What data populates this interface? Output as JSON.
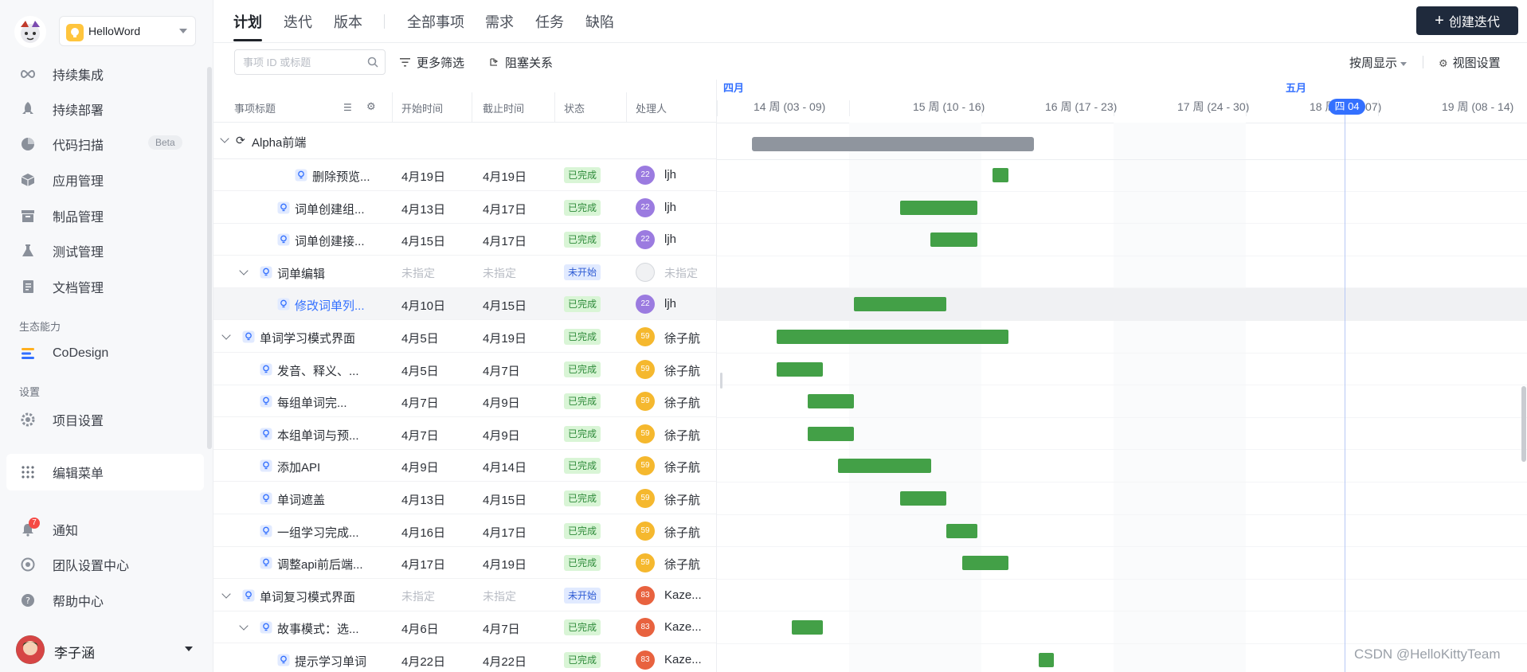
{
  "sidebar": {
    "project": "HelloWord",
    "items": [
      {
        "label": "持续集成",
        "icon": "infinity-icon"
      },
      {
        "label": "持续部署",
        "icon": "rocket-icon"
      },
      {
        "label": "代码扫描",
        "icon": "pie-chart-icon",
        "tag": "Beta"
      },
      {
        "label": "应用管理",
        "icon": "cube-icon"
      },
      {
        "label": "制品管理",
        "icon": "archive-icon"
      },
      {
        "label": "测试管理",
        "icon": "flask-icon"
      },
      {
        "label": "文档管理",
        "icon": "document-icon"
      }
    ],
    "section_eco": "生态能力",
    "codesign": "CoDesign",
    "section_settings": "设置",
    "project_settings": "项目设置",
    "edit_menu": "编辑菜单",
    "notifications": "通知",
    "notifications_count": "7",
    "team_center": "团队设置中心",
    "help_center": "帮助中心",
    "user": "李子涵"
  },
  "tabs": [
    "计划",
    "迭代",
    "版本",
    "全部事项",
    "需求",
    "任务",
    "缺陷"
  ],
  "create_button": "创建迭代",
  "filters": {
    "search_placeholder": "事项 ID 或标题",
    "more_filters": "更多筛选",
    "blocking": "阻塞关系",
    "week_display": "按周显示",
    "view_settings": "视图设置"
  },
  "columns": {
    "title": "事项标题",
    "start": "开始时间",
    "end": "截止时间",
    "status": "状态",
    "assignee": "处理人"
  },
  "group": {
    "name": "Alpha前端"
  },
  "rows": [
    {
      "title": "删除预览...",
      "start": "4月19日",
      "end": "4月19日",
      "status": "已完成",
      "avatar": "22",
      "assignee": "ljh"
    },
    {
      "title": "词单创建组...",
      "start": "4月13日",
      "end": "4月17日",
      "status": "已完成",
      "avatar": "22",
      "assignee": "ljh"
    },
    {
      "title": "词单创建接...",
      "start": "4月15日",
      "end": "4月17日",
      "status": "已完成",
      "avatar": "22",
      "assignee": "ljh"
    },
    {
      "title": "词单编辑",
      "start": "未指定",
      "end": "未指定",
      "status": "未开始",
      "avatar": "",
      "assignee": "未指定"
    },
    {
      "title": "修改词单列...",
      "start": "4月10日",
      "end": "4月15日",
      "status": "已完成",
      "avatar": "22",
      "assignee": "ljh"
    },
    {
      "title": "单词学习模式界面",
      "start": "4月5日",
      "end": "4月19日",
      "status": "已完成",
      "avatar": "59",
      "assignee": "徐子航"
    },
    {
      "title": "发音、释义、...",
      "start": "4月5日",
      "end": "4月7日",
      "status": "已完成",
      "avatar": "59",
      "assignee": "徐子航"
    },
    {
      "title": "每组单词完...",
      "start": "4月7日",
      "end": "4月9日",
      "status": "已完成",
      "avatar": "59",
      "assignee": "徐子航"
    },
    {
      "title": "本组单词与预...",
      "start": "4月7日",
      "end": "4月9日",
      "status": "已完成",
      "avatar": "59",
      "assignee": "徐子航"
    },
    {
      "title": "添加API",
      "start": "4月9日",
      "end": "4月14日",
      "status": "已完成",
      "avatar": "59",
      "assignee": "徐子航"
    },
    {
      "title": "单词遮盖",
      "start": "4月13日",
      "end": "4月15日",
      "status": "已完成",
      "avatar": "59",
      "assignee": "徐子航"
    },
    {
      "title": "一组学习完成...",
      "start": "4月16日",
      "end": "4月17日",
      "status": "已完成",
      "avatar": "59",
      "assignee": "徐子航"
    },
    {
      "title": "调整api前后端...",
      "start": "4月17日",
      "end": "4月19日",
      "status": "已完成",
      "avatar": "59",
      "assignee": "徐子航"
    },
    {
      "title": "单词复习模式界面",
      "start": "未指定",
      "end": "未指定",
      "status": "未开始",
      "avatar": "83",
      "assignee": "Kaze..."
    },
    {
      "title": "故事模式：选...",
      "start": "4月6日",
      "end": "4月7日",
      "status": "已完成",
      "avatar": "83",
      "assignee": "Kaze..."
    },
    {
      "title": "提示学习单词",
      "start": "4月22日",
      "end": "4月22日",
      "status": "已完成",
      "avatar": "83",
      "assignee": "Kaze..."
    }
  ],
  "timeline": {
    "months": [
      "四月",
      "五月"
    ],
    "weeks": [
      "14 周 (03 - 09)",
      "15 周 (10 - 16)",
      "16 周 (17 - 23)",
      "17 周 (24 - 30)",
      "18 周 (01 - 07)",
      "19 周 (08 - 14)"
    ],
    "today": "四 04"
  },
  "colors": {
    "done_bar": "#43a047",
    "summary_bar": "#8f959e",
    "accent": "#3370ff",
    "create_button": "#1f2a3c"
  },
  "watermark": "CSDN @HelloKittyTeam"
}
